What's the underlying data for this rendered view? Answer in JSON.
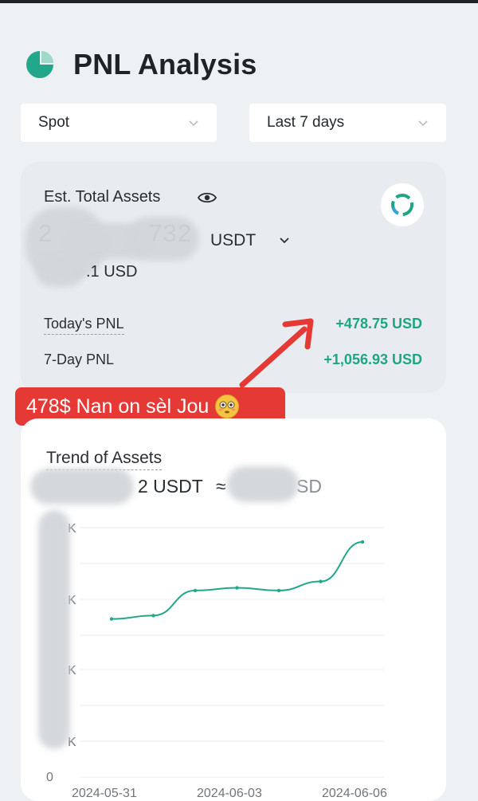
{
  "header": {
    "title": "PNL Analysis",
    "icon": "pie-chart-icon",
    "accent": "#22a78a"
  },
  "filters": {
    "market": {
      "value": "Spot"
    },
    "range": {
      "value": "Last 7 days"
    }
  },
  "assets": {
    "label": "Est. Total Assets",
    "total_visible": "732",
    "total_prefix": "2",
    "unit": "USDT",
    "usd_visible": ".1 USD"
  },
  "pnl": {
    "today_label": "Today's PNL",
    "today_value": "+478.75 USD",
    "week_label": "7-Day PNL",
    "week_value": "+1,056.93 USD",
    "positive_color": "#1fa584"
  },
  "annotation": {
    "text": "478$ Nan on sèl Jou",
    "color": "#e53935"
  },
  "trend": {
    "title": "Trend of Assets",
    "value_fragment": "2 USDT",
    "approx": "≈",
    "usd_fragment": "SD"
  },
  "chart_data": {
    "type": "line",
    "x": [
      "2024-05-31",
      "2024-06-01",
      "2024-06-02",
      "2024-06-03",
      "2024-06-04",
      "2024-06-05",
      "2024-06-06"
    ],
    "series": [
      {
        "values": [
          0.77,
          0.78,
          0.855,
          0.863,
          0.855,
          0.882,
          1.0
        ]
      }
    ],
    "x_tick_labels": [
      "2024-05-31",
      "2024-06-03",
      "2024-06-06"
    ],
    "y_tick_labels": [
      "K",
      "K",
      "K",
      "K",
      "",
      "0"
    ],
    "ylim": [
      0,
      1
    ],
    "grid": true,
    "line_color": "#22a78a"
  }
}
